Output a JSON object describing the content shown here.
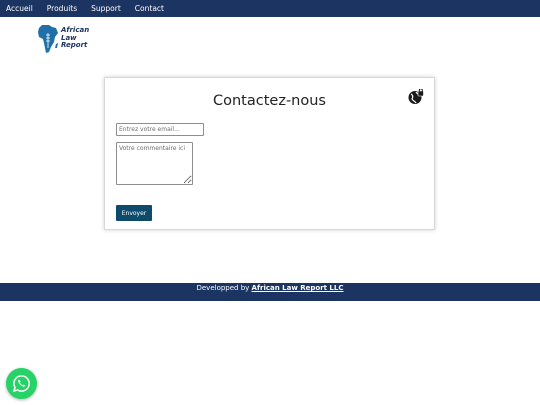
{
  "nav": {
    "items": [
      {
        "label": "Accueil"
      },
      {
        "label": "Produits"
      },
      {
        "label": "Support"
      },
      {
        "label": "Contact"
      }
    ]
  },
  "logo": {
    "line1": "African",
    "line2": "Law",
    "line3": "Report"
  },
  "form": {
    "title": "Contactez-nous",
    "email_placeholder": "Entrez votre email...",
    "comment_placeholder": "Votre commentaire ici",
    "submit_label": "Envoyer",
    "icon": "globe-lock-icon"
  },
  "footer": {
    "prefix": "Developped by",
    "company": "African Law Report LLC"
  },
  "whatsapp": {
    "icon": "whatsapp-icon",
    "color": "#25d366"
  },
  "colors": {
    "nav_bg": "#1c3461",
    "button_bg": "#0d4a6b"
  }
}
